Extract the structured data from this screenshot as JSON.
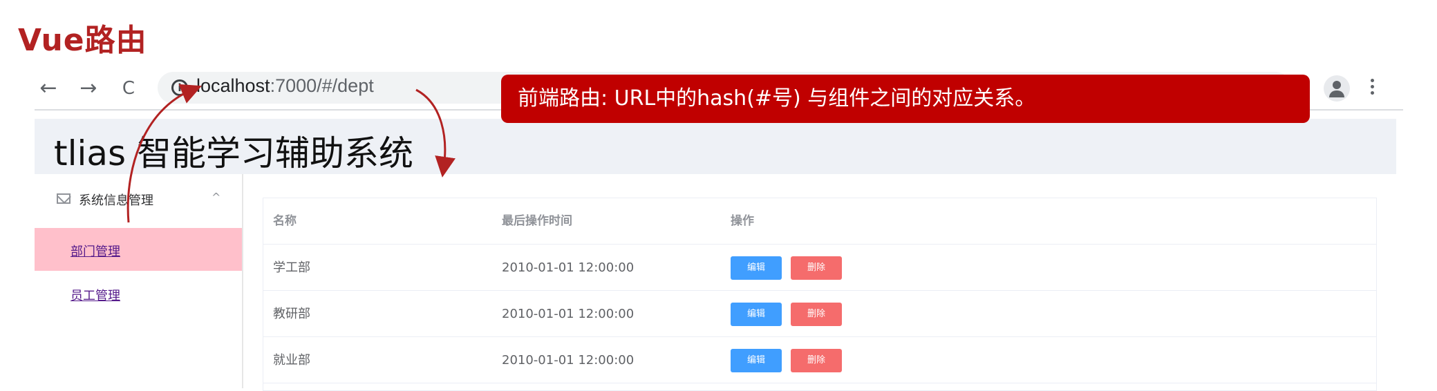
{
  "slide": {
    "title": "Vue路由"
  },
  "browser": {
    "url_host": "localhost",
    "url_path": ":7000/#/dept",
    "back_glyph": "←",
    "forward_glyph": "→",
    "reload_glyph": "C",
    "info_glyph": "i"
  },
  "callout": {
    "text": "前端路由: URL中的hash(#号) 与组件之间的对应关系。"
  },
  "app": {
    "title": "tlias 智能学习辅助系统",
    "sidebar": {
      "group_label": "系统信息管理",
      "group_chevron": "^",
      "items": [
        {
          "label": "部门管理",
          "active": true
        },
        {
          "label": "员工管理",
          "active": false
        }
      ]
    },
    "table": {
      "columns": [
        "名称",
        "最后操作时间",
        "操作"
      ],
      "rows": [
        {
          "name": "学工部",
          "time": "2010-01-01 12:00:00"
        },
        {
          "name": "教研部",
          "time": "2010-01-01 12:00:00"
        },
        {
          "name": "就业部",
          "time": "2010-01-01 12:00:00"
        }
      ],
      "edit_label": "编辑",
      "delete_label": "删除"
    }
  },
  "colors": {
    "title_red": "#b22222",
    "callout_bg": "#c00000",
    "active_menu_bg": "#ffc0cb",
    "edit_button": "#409eff",
    "delete_button": "#f56c6c",
    "header_bg": "#eef1f6"
  },
  "icons": [
    "back-arrow-icon",
    "forward-arrow-icon",
    "reload-icon",
    "info-icon",
    "profile-icon",
    "more-vert-icon",
    "mail-icon",
    "chevron-up-icon"
  ]
}
